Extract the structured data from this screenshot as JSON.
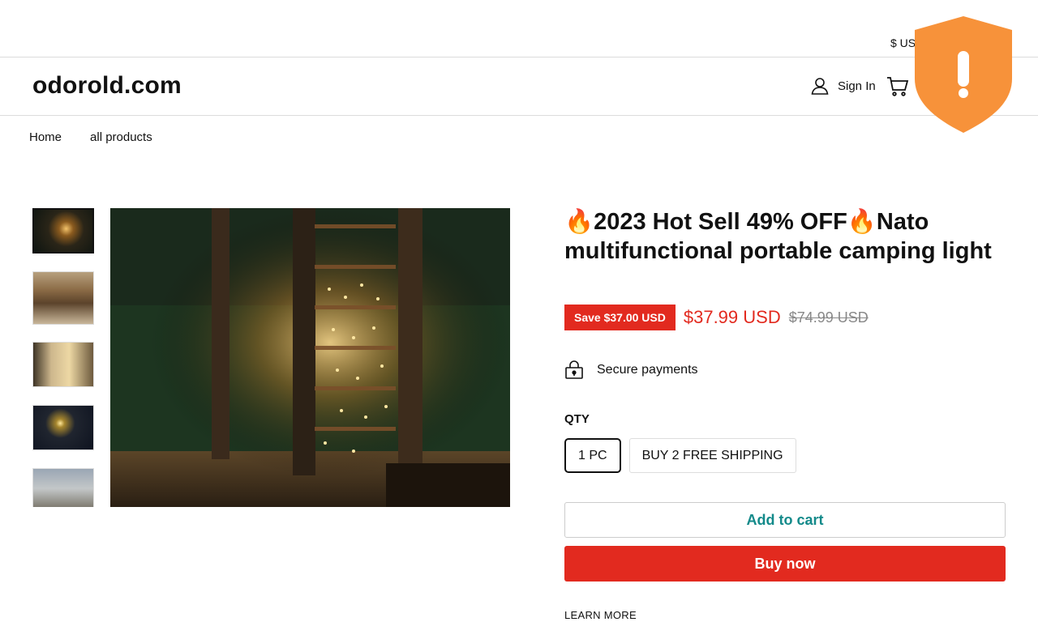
{
  "topbar": {
    "currency": "$ US"
  },
  "header": {
    "logo": "odorold.com",
    "sign_in": "Sign In"
  },
  "nav": {
    "items": [
      "Home",
      "all products"
    ]
  },
  "product": {
    "title": "🔥2023 Hot Sell 49% OFF🔥Nato multifunctional portable camping light",
    "save_badge": "Save $37.00 USD",
    "price": "$37.99 USD",
    "compare_price": "$74.99 USD",
    "secure": "Secure payments",
    "qty_label": "QTY",
    "variants": [
      "1 PC",
      "BUY 2 FREE SHIPPING"
    ],
    "selected_variant": "1 PC",
    "add_to_cart": "Add to cart",
    "buy_now": "Buy now",
    "learn_more": "LEARN MORE"
  },
  "colors": {
    "accent_red": "#e22a1f",
    "teal": "#138a8a",
    "shield_orange": "#f7923a"
  },
  "icons": [
    "user-icon",
    "cart-icon",
    "lock-icon",
    "shield-alert-icon"
  ]
}
